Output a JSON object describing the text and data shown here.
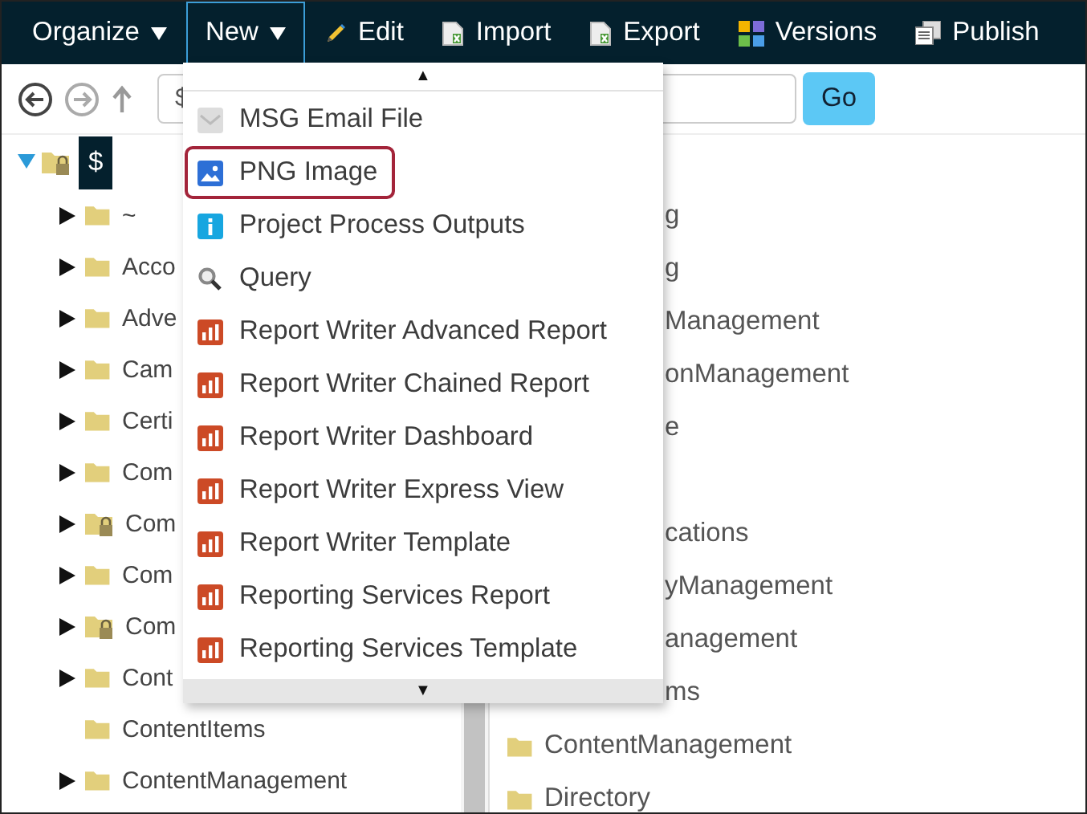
{
  "toolbar": [
    {
      "label": "Organize",
      "kind": "dropdown",
      "selected": false
    },
    {
      "label": "New",
      "kind": "dropdown",
      "selected": true
    },
    {
      "label": "Edit",
      "kind": "pencil",
      "selected": false
    },
    {
      "label": "Import",
      "kind": "document",
      "selected": false
    },
    {
      "label": "Export",
      "kind": "document",
      "selected": false
    },
    {
      "label": "Versions",
      "kind": "grid",
      "selected": false
    },
    {
      "label": "Publish",
      "kind": "stack",
      "selected": false
    }
  ],
  "address_bar": {
    "value": "$",
    "button": "Go"
  },
  "tree": {
    "label": "$",
    "expanded": true,
    "selected": true,
    "locked": true,
    "children": [
      {
        "label": "~",
        "expandable": true,
        "locked": false
      },
      {
        "label": "Acco",
        "expandable": true,
        "locked": false
      },
      {
        "label": "Adve",
        "expandable": true,
        "locked": false
      },
      {
        "label": "Cam",
        "expandable": true,
        "locked": false
      },
      {
        "label": "Certi",
        "expandable": true,
        "locked": false
      },
      {
        "label": "Com",
        "expandable": true,
        "locked": false
      },
      {
        "label": "Com",
        "expandable": true,
        "locked": true
      },
      {
        "label": "Com",
        "expandable": true,
        "locked": false
      },
      {
        "label": "Com",
        "expandable": true,
        "locked": true
      },
      {
        "label": "Cont",
        "expandable": true,
        "locked": false
      },
      {
        "label": "ContentItems",
        "expandable": false,
        "locked": false
      },
      {
        "label": "ContentManagement",
        "expandable": true,
        "locked": false
      }
    ]
  },
  "list_upper": [
    {
      "label": "g",
      "kind": "covered"
    },
    {
      "label": "g",
      "kind": "covered"
    },
    {
      "label": "Management",
      "kind": "covered"
    },
    {
      "label": "onManagement",
      "kind": "covered"
    },
    {
      "label": "e",
      "kind": "covered"
    }
  ],
  "list_lower": [
    {
      "label": "cations",
      "kind": "covered"
    },
    {
      "label": "yManagement",
      "kind": "covered"
    },
    {
      "label": "anagement",
      "kind": "covered"
    },
    {
      "label": "ms",
      "kind": "covered"
    },
    {
      "label": "ContentManagement",
      "kind": "folder"
    },
    {
      "label": "Directory",
      "kind": "folder"
    }
  ],
  "new_menu": {
    "scroll_up": "▲",
    "scroll_down": "▼",
    "items": [
      {
        "label": "MSG Email File",
        "kind": "envelope",
        "selected": false
      },
      {
        "label": "PNG Image",
        "kind": "image",
        "selected": true
      },
      {
        "label": "Project Process Outputs",
        "kind": "info",
        "selected": false
      },
      {
        "label": "Query",
        "kind": "search",
        "selected": false
      },
      {
        "label": "Report Writer Advanced Report",
        "kind": "chart",
        "selected": false
      },
      {
        "label": "Report Writer Chained Report",
        "kind": "chart",
        "selected": false
      },
      {
        "label": "Report Writer Dashboard",
        "kind": "chart",
        "selected": false
      },
      {
        "label": "Report Writer Express View",
        "kind": "chart",
        "selected": false
      },
      {
        "label": "Report Writer Template",
        "kind": "chart",
        "selected": false
      },
      {
        "label": "Reporting Services Report",
        "kind": "chart",
        "selected": false
      },
      {
        "label": "Reporting Services Template",
        "kind": "chart",
        "selected": false
      }
    ]
  }
}
